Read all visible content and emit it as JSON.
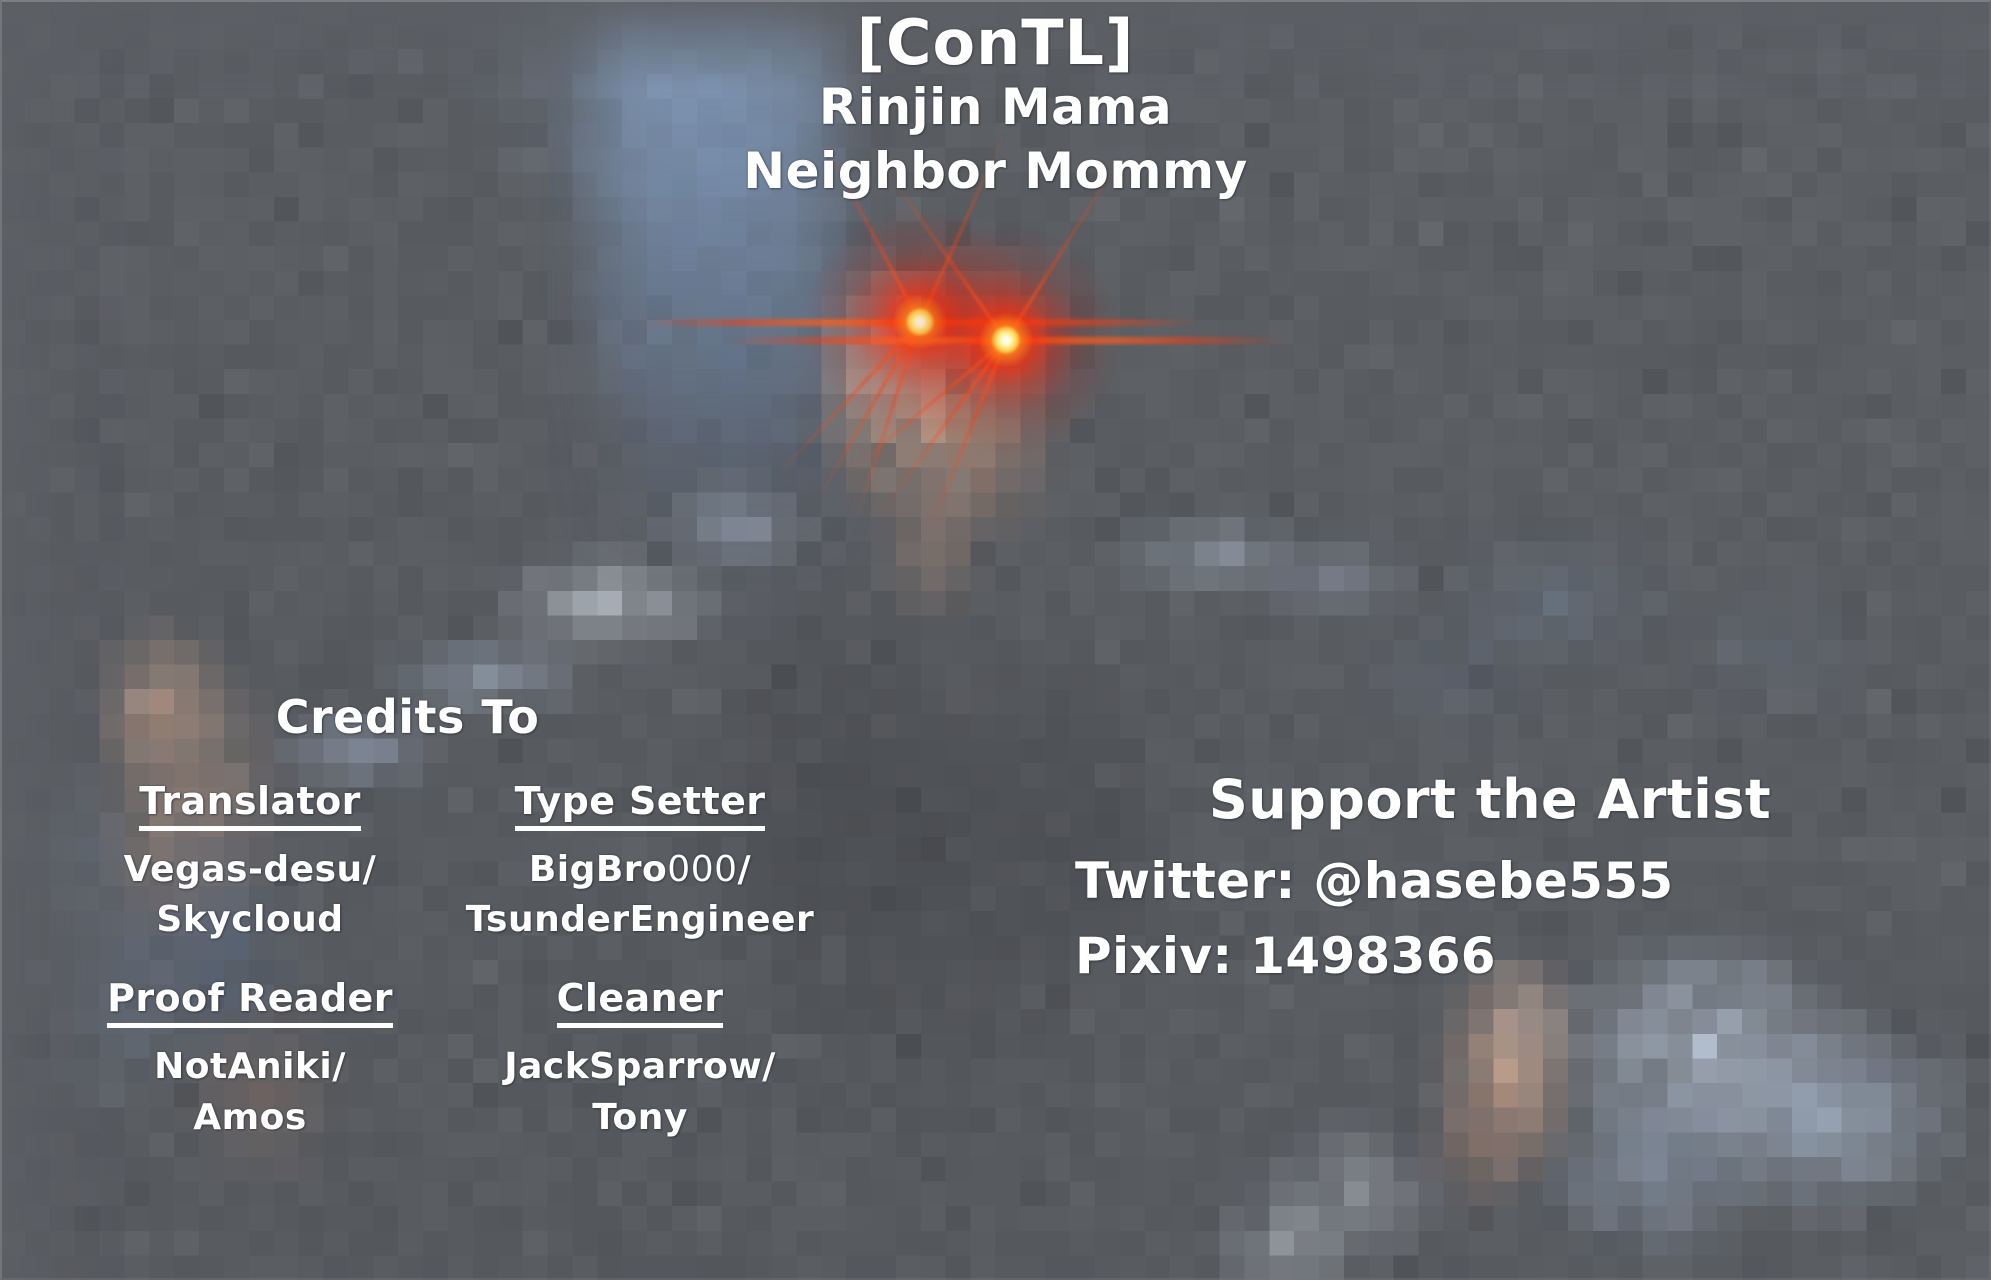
{
  "header": {
    "group_tag": "[ConTL]",
    "title_romaji": "Rinjin Mama",
    "title_english": "Neighbor Mommy"
  },
  "credits": {
    "heading": "Credits To",
    "roles": [
      {
        "role": "Translator",
        "names": [
          "Vegas-desu/",
          "Skycloud"
        ]
      },
      {
        "role": "Type Setter",
        "names": [
          "BigBro000/",
          "TsunderEngineer"
        ],
        "name_light_suffix": "000"
      },
      {
        "role": "Proof Reader",
        "names": [
          "NotAniki/",
          "Amos"
        ]
      },
      {
        "role": "Cleaner",
        "names": [
          "JackSparrow/",
          "Tony"
        ]
      }
    ]
  },
  "support": {
    "heading": "Support the Artist",
    "twitter_label": "Twitter:",
    "twitter_handle": "@hasebe555",
    "twitter_line": "Twitter: @hasebe555",
    "pixiv_label": "Pixiv:",
    "pixiv_id": "1498366",
    "pixiv_line": "Pixiv: 1498366"
  },
  "visual": {
    "text_color": "#ffffff",
    "background_base": "#5b5e63",
    "eye_glow_core": "#fffbd0",
    "eye_glow_mid": "#ffb428",
    "eye_glow_outer": "#e01e08",
    "accent_blue": "#8aa3c4",
    "skin_tone": "#c9a38c"
  }
}
